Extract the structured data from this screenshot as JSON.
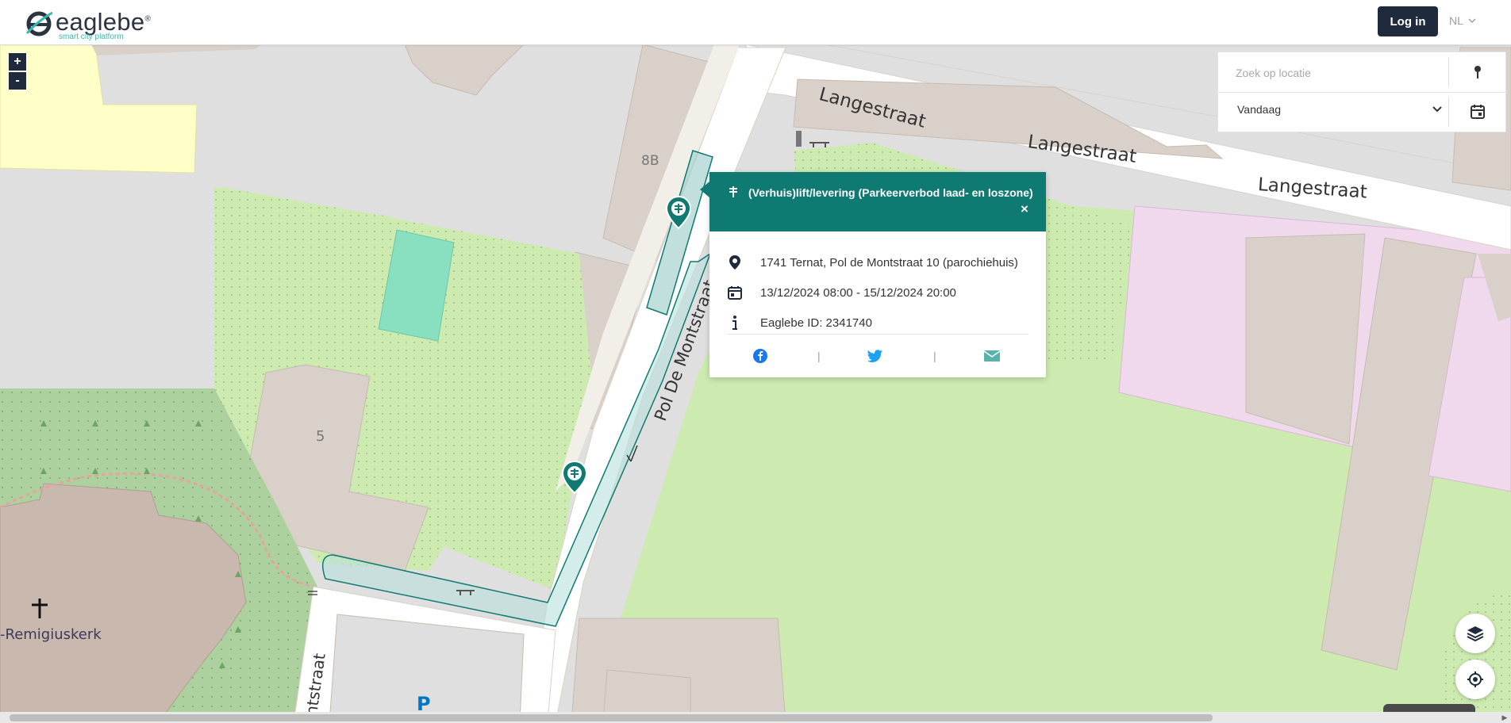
{
  "header": {
    "logo_word": "eaglebe",
    "logo_registered": "®",
    "logo_tagline": "smart city platform",
    "login_label": "Log in",
    "language": "NL"
  },
  "map_controls": {
    "zoom_in": "+",
    "zoom_out": "-"
  },
  "search": {
    "placeholder": "Zoek op locatie",
    "date_value": "Vandaag"
  },
  "popup": {
    "title": "(Verhuis)lift/levering (Parkeerverbod laad- en loszone)",
    "close": "×",
    "address": "1741 Ternat, Pol de Montstraat 10 (parochiehuis)",
    "period": "13/12/2024 08:00 - 15/12/2024 20:00",
    "id_text": "Eaglebe ID: 2341740",
    "share_separator": "|"
  },
  "map_labels": {
    "street_1": "Langestraat",
    "street_2": "Langestraat",
    "street_3": "Langestraat",
    "street_pol": "Pol De Montstraat",
    "street_bottom": "ntstraat",
    "church": "-Remigiuskerk",
    "house_8b": "8B",
    "house_5": "5",
    "parking": "P"
  },
  "colors": {
    "accent": "#0f7a72",
    "header_button": "#1f2a3c",
    "grass": "#cdebb0",
    "building": "#d9d0c9",
    "forest": "#add19e"
  },
  "icons": {
    "search_pin": "map-pin-icon",
    "calendar": "calendar-icon",
    "layers": "layers-icon",
    "locate": "locate-icon",
    "facebook": "facebook-icon",
    "twitter": "twitter-icon",
    "mail": "mail-icon"
  }
}
